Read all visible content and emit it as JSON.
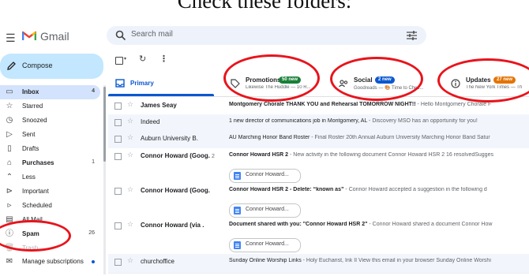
{
  "caption": "Check these folders:",
  "app": {
    "name": "Gmail"
  },
  "search": {
    "placeholder": "Search mail"
  },
  "compose": {
    "label": "Compose"
  },
  "sidebar": {
    "items": [
      {
        "label": "Inbox",
        "count": "4",
        "icon": "inbox-icon",
        "glyph": "▭"
      },
      {
        "label": "Starred",
        "count": "",
        "icon": "star-icon",
        "glyph": "☆"
      },
      {
        "label": "Snoozed",
        "count": "",
        "icon": "clock-icon",
        "glyph": "◷"
      },
      {
        "label": "Sent",
        "count": "",
        "icon": "send-icon",
        "glyph": "▷"
      },
      {
        "label": "Drafts",
        "count": "",
        "icon": "draft-icon",
        "glyph": "▯"
      },
      {
        "label": "Purchases",
        "count": "1",
        "icon": "shopping-bag-icon",
        "glyph": "⌂"
      },
      {
        "label": "Less",
        "count": "",
        "icon": "chevron-up-icon",
        "glyph": "⌃"
      },
      {
        "label": "Important",
        "count": "",
        "icon": "label-important-icon",
        "glyph": "⊳"
      },
      {
        "label": "Scheduled",
        "count": "",
        "icon": "schedule-send-icon",
        "glyph": "▹"
      },
      {
        "label": "All Mail",
        "count": "",
        "icon": "all-mail-icon",
        "glyph": "▤"
      },
      {
        "label": "Spam",
        "count": "26",
        "icon": "report-icon",
        "glyph": "ⓘ"
      },
      {
        "label": "Trash",
        "count": "",
        "icon": "trash-icon",
        "glyph": "🗑"
      },
      {
        "label": "Manage subscriptions",
        "count": "",
        "icon": "manage-subscriptions-icon",
        "glyph": "✉"
      }
    ]
  },
  "tabs": [
    {
      "label": "Primary",
      "badge": "",
      "sub": "",
      "icon": "inbox-icon"
    },
    {
      "label": "Promotions",
      "badge": "50 new",
      "badge_color": "#188038",
      "sub": "Likewise The Huddle — 10 R...",
      "icon": "tag-icon"
    },
    {
      "label": "Social",
      "badge": "2 new",
      "badge_color": "#0b57d0",
      "sub": "Goodreads — 🎨 Time to Chec...",
      "icon": "people-icon"
    },
    {
      "label": "Updates",
      "badge": "27 new",
      "badge_color": "#e37400",
      "sub": "The New York Times — Th",
      "icon": "info-icon"
    }
  ],
  "emails": [
    {
      "sender": "James Seay",
      "count": "",
      "subject": "Montgomery Chorale THANK YOU and Rehearsal TOMORROW NIGHT!!",
      "snippet": " - Hello Montgomery Chorale F",
      "unread": true,
      "chip": ""
    },
    {
      "sender": "Indeed",
      "count": "",
      "subject": "1 new director of communications job in Montgomery, AL",
      "snippet": " - Discovery MSO has an opportunity for you!",
      "unread": false,
      "chip": ""
    },
    {
      "sender": "Auburn University B.",
      "count": "",
      "subject": "AU Marching Honor Band Roster",
      "snippet": " - Final Roster 20th Annual Auburn University Marching Honor Band Satur",
      "unread": false,
      "chip": ""
    },
    {
      "sender": "Connor Howard (Goog.",
      "count": "2",
      "subject": "Connor Howard HSR 2",
      "snippet": " - New activity in the following document Connor Howard HSR 2 16 resolvedSugges",
      "unread": true,
      "chip": "Connor Howard..."
    },
    {
      "sender": "Connor Howard (Goog.",
      "count": "",
      "subject": "Connor Howard HSR 2 - Delete: “known as”",
      "snippet": " - Connor Howard accepted a suggestion in the following d",
      "unread": true,
      "chip": "Connor Howard..."
    },
    {
      "sender": "Connor Howard (via .",
      "count": "",
      "subject": "Document shared with you: \"Connor Howard HSR 2\"",
      "snippet": " - Connor Howard shared a document Connor How",
      "unread": true,
      "chip": "Connor Howard..."
    },
    {
      "sender": "churchoffice",
      "count": "",
      "subject": "Sunday Online Worship Links",
      "snippet": " - Holy Eucharist, Ink II View this email in your browser Sunday Online Worshi",
      "unread": false,
      "chip": ""
    }
  ],
  "colors": {
    "accent": "#0b57d0",
    "annotation": "#e8141c",
    "compose_bg": "#c2e7ff"
  }
}
